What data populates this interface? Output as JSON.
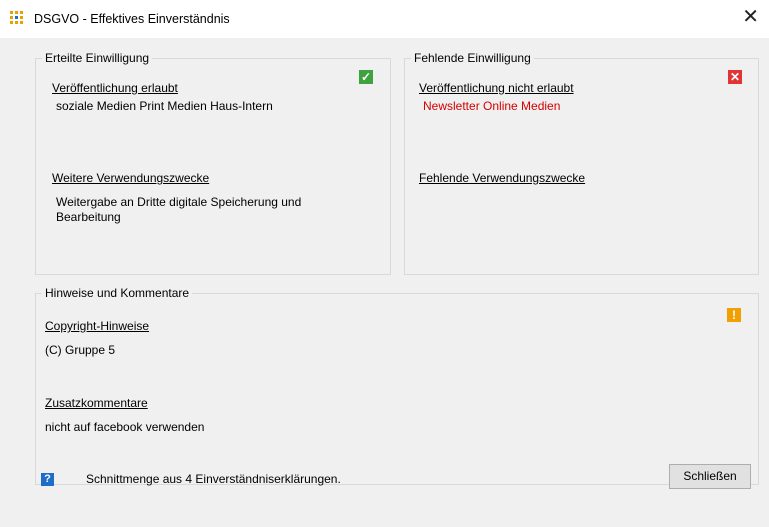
{
  "window": {
    "title": "DSGVO - Effektives Einverständnis",
    "close_glyph": "✕"
  },
  "given": {
    "legend": "Erteilte Einwilligung",
    "publication_link": "Veröffentlichung erlaubt",
    "publication_values": "soziale Medien Print Medien Haus-Intern",
    "purposes_link": "Weitere Verwendungszwecke",
    "purposes_values": "Weitergabe an Dritte digitale Speicherung und Bearbeitung",
    "status_icon": "check-icon",
    "status_glyph": "✓",
    "status_color": "#3ea33e"
  },
  "missing": {
    "legend": "Fehlende Einwilligung",
    "publication_link": "Veröffentlichung nicht erlaubt",
    "publication_values": "Newsletter Online Medien",
    "purposes_link": "Fehlende Verwendungszwecke",
    "status_icon": "x-icon",
    "status_glyph": "✕",
    "status_color": "#e03535"
  },
  "notes": {
    "legend": "Hinweise und Kommentare",
    "copyright_link": "Copyright-Hinweise",
    "copyright_value": "(C) Gruppe 5",
    "comments_link": "Zusatzkommentare",
    "comments_value": "nicht auf facebook verwenden",
    "status_icon": "warning-icon",
    "status_glyph": "!",
    "status_color": "#f0a000"
  },
  "footer": {
    "help_glyph": "?",
    "status_text": "Schnittmenge aus 4 Einverständniserklärungen.",
    "close_button": "Schließen"
  }
}
